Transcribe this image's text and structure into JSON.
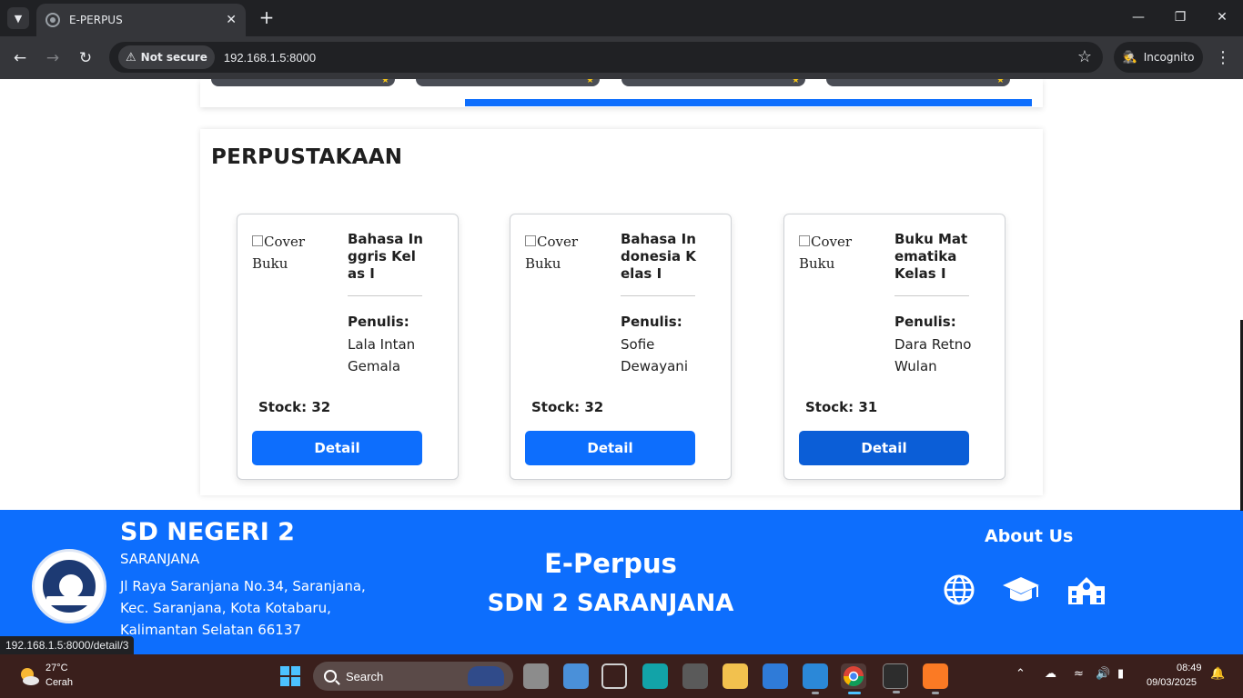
{
  "browser": {
    "tab_title": "E-PERPUS",
    "security_label": "Not secure",
    "url": "192.168.1.5:8000",
    "incognito_label": "Incognito",
    "status_url": "192.168.1.5:8000/detail/3"
  },
  "colors": {
    "primary": "#0d6efd",
    "primary_hover": "#0b5ed7",
    "chrome_dark": "#202124",
    "taskbar": "#3a1f1c"
  },
  "library": {
    "heading": "PERPUSTAKAAN",
    "cover_alt": "Cover Buku",
    "author_label": "Penulis:",
    "stock_prefix": "Stock: ",
    "detail_label": "Detail",
    "books": [
      {
        "title": "Bahasa Inggris Kelas I",
        "author": "Lala Intan Gemala",
        "stock": 32,
        "stock_text": "Stock: 32"
      },
      {
        "title": "Bahasa Indonesia Kelas I",
        "author": "Sofie Dewayani",
        "stock": 32,
        "stock_text": "Stock: 32"
      },
      {
        "title": "Buku Matematika Kelas I",
        "author": "Dara Retno Wulan",
        "stock": 31,
        "stock_text": "Stock: 31"
      }
    ]
  },
  "footer": {
    "school_name": "SD NEGERI 2",
    "school_sub": "SARANJANA",
    "address": "Jl Raya Saranjana No.34, Saranjana, Kec. Saranjana, Kota Kotabaru, Kalimantan Selatan 66137",
    "app_name": "E-Perpus",
    "app_school": "SDN 2 SARANJANA",
    "about_label": "About Us",
    "icons": [
      "globe-icon",
      "graduation-cap-icon",
      "school-icon"
    ]
  },
  "taskbar": {
    "temperature": "27°C",
    "condition": "Cerah",
    "search_placeholder": "Search",
    "time": "08:49",
    "date": "09/03/2025"
  }
}
